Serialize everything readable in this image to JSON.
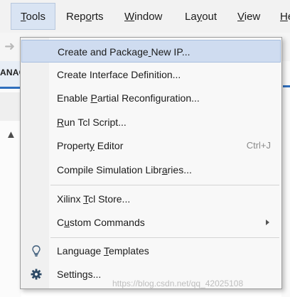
{
  "menubar": {
    "items": [
      {
        "label": "Tools",
        "mnemonic_index": 0,
        "active": true
      },
      {
        "label": "Reports",
        "mnemonic_index": 3
      },
      {
        "label": "Window",
        "mnemonic_index": 0
      },
      {
        "label": "Layout",
        "mnemonic_index": 2
      },
      {
        "label": "View",
        "mnemonic_index": 0
      },
      {
        "label": "He",
        "mnemonic_index": 0
      }
    ]
  },
  "background": {
    "side_label": "ANAG"
  },
  "dropdown": {
    "items": [
      {
        "label": "Create and Package New IP...",
        "mnemonic_index": 18,
        "highlighted": true
      },
      {
        "label": "Create Interface Definition...",
        "mnemonic_index": -1
      },
      {
        "label": "Enable Partial Reconfiguration...",
        "mnemonic_index": 7
      },
      {
        "label": "Run Tcl Script...",
        "mnemonic_index": 0
      },
      {
        "label": "Property Editor",
        "mnemonic_index": 7,
        "accelerator": "Ctrl+J"
      },
      {
        "label": "Compile Simulation Libraries...",
        "mnemonic_index": 23
      },
      {
        "label": "Xilinx Tcl Store...",
        "mnemonic_index": 7
      },
      {
        "label": "Custom Commands",
        "mnemonic_index": 1,
        "has_submenu": true
      },
      {
        "label": "Language Templates",
        "mnemonic_index": 9,
        "icon": "lightbulb-icon"
      },
      {
        "label": "Settings...",
        "mnemonic_index": -1,
        "icon": "gear-icon"
      }
    ]
  },
  "watermark": {
    "text": "https://blog.csdn.net/qq_42025108"
  },
  "colors": {
    "menu_highlight": "#cfdcf0",
    "active_menu_bg": "#d9e4f3",
    "accent_blue": "#2f6fbe"
  }
}
